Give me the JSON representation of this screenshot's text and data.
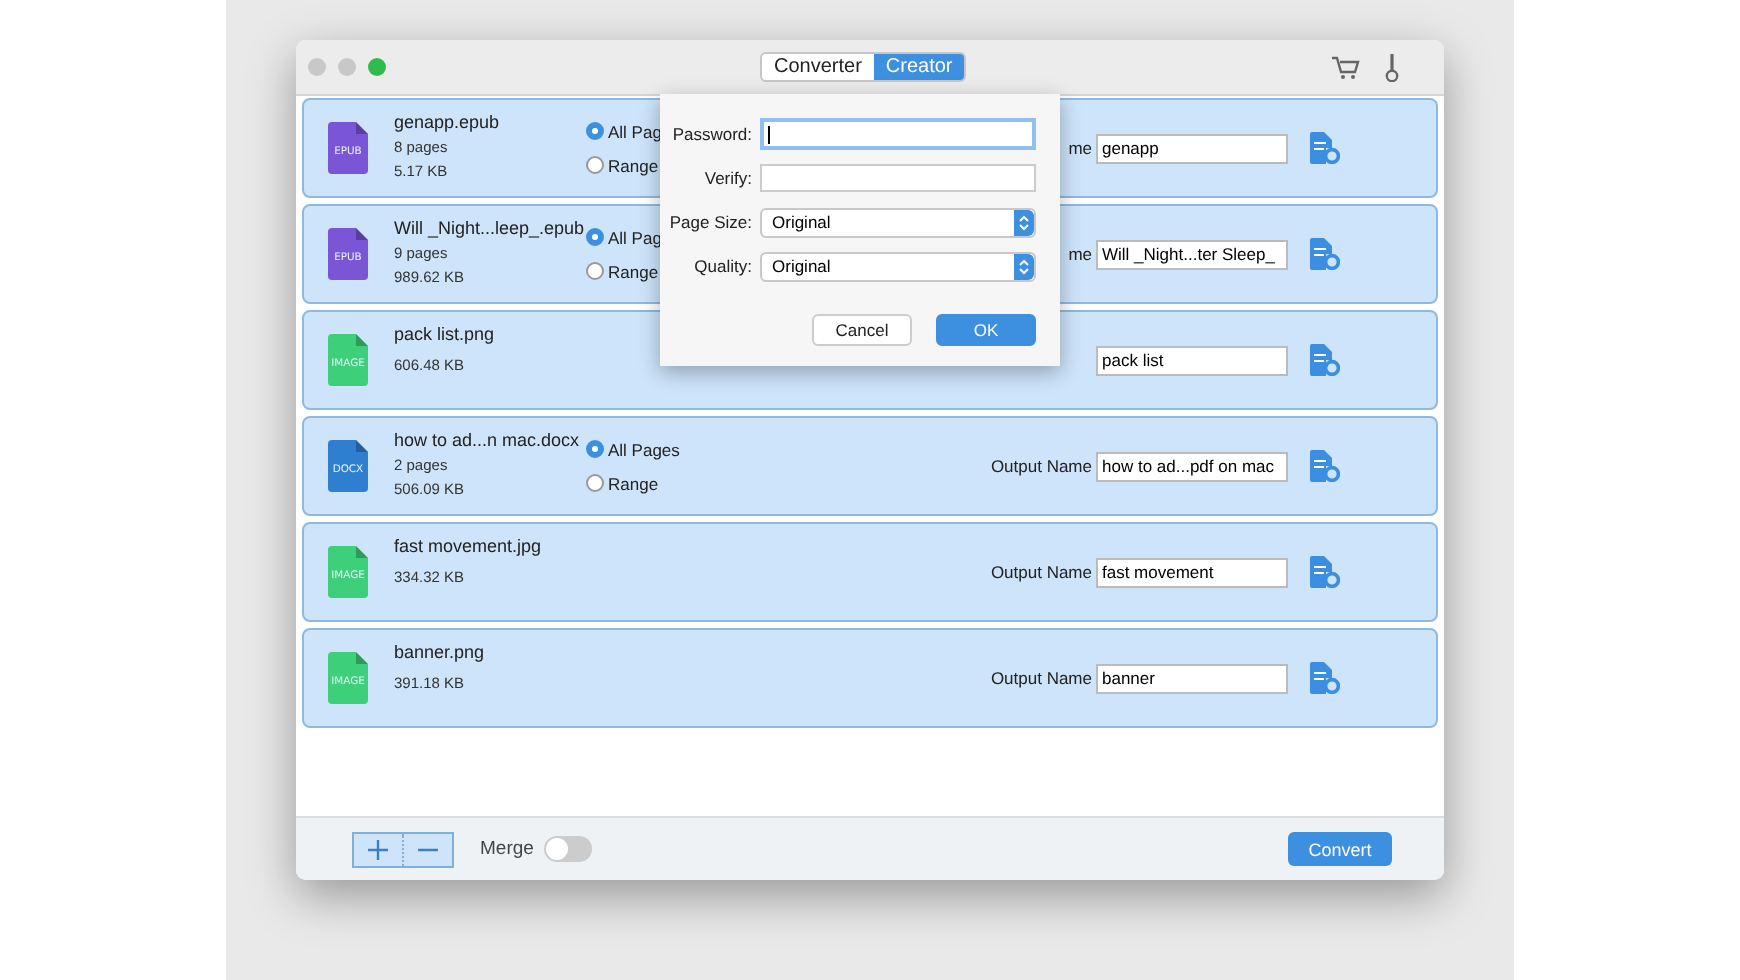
{
  "window": {
    "tabs": [
      {
        "label": "Converter",
        "selected": false
      },
      {
        "label": "Creator",
        "selected": true
      }
    ]
  },
  "files": [
    {
      "name": "genapp.epub",
      "kind": "epub",
      "icon_label": "EPUB",
      "pages": "8 pages",
      "size": "5.17 KB",
      "page_options": [
        {
          "label": "All Pag",
          "selected": true
        },
        {
          "label": "Range",
          "selected": false
        }
      ],
      "output_label": "me",
      "output_name": "genapp"
    },
    {
      "name": "Will _Night...leep_.epub",
      "kind": "epub",
      "icon_label": "EPUB",
      "pages": "9 pages",
      "size": "989.62 KB",
      "page_options": [
        {
          "label": "All Pag",
          "selected": true
        },
        {
          "label": "Range",
          "selected": false
        }
      ],
      "output_label": "me",
      "output_name": "Will _Night...ter Sleep_"
    },
    {
      "name": "pack list.png",
      "kind": "image",
      "icon_label": "IMAGE",
      "size": "606.48 KB",
      "output_name": "pack list"
    },
    {
      "name": "how to ad...n mac.docx",
      "kind": "docx",
      "icon_label": "DOCX",
      "pages": "2 pages",
      "size": "506.09 KB",
      "page_options": [
        {
          "label": "All Pages",
          "selected": true
        },
        {
          "label": "Range",
          "selected": false
        }
      ],
      "output_label": "Output Name",
      "output_name": "how to ad...pdf on mac"
    },
    {
      "name": "fast movement.jpg",
      "kind": "image",
      "icon_label": "IMAGE",
      "size": "334.32 KB",
      "output_label": "Output Name",
      "output_name": "fast movement"
    },
    {
      "name": "banner.png",
      "kind": "image",
      "icon_label": "IMAGE",
      "size": "391.18 KB",
      "output_label": "Output Name",
      "output_name": "banner"
    }
  ],
  "dialog": {
    "fields": [
      {
        "label": "Password:",
        "kind": "text",
        "focused": true
      },
      {
        "label": "Verify:",
        "kind": "text",
        "focused": false
      },
      {
        "label": "Page Size:",
        "kind": "select",
        "value": "Original"
      },
      {
        "label": "Quality:",
        "kind": "select",
        "value": "Original"
      }
    ],
    "buttons": [
      {
        "label": "Cancel",
        "primary": false
      },
      {
        "label": "OK",
        "primary": true
      }
    ]
  },
  "footer": {
    "merge": {
      "label": "Merge",
      "on": false
    },
    "convert": "Convert"
  }
}
